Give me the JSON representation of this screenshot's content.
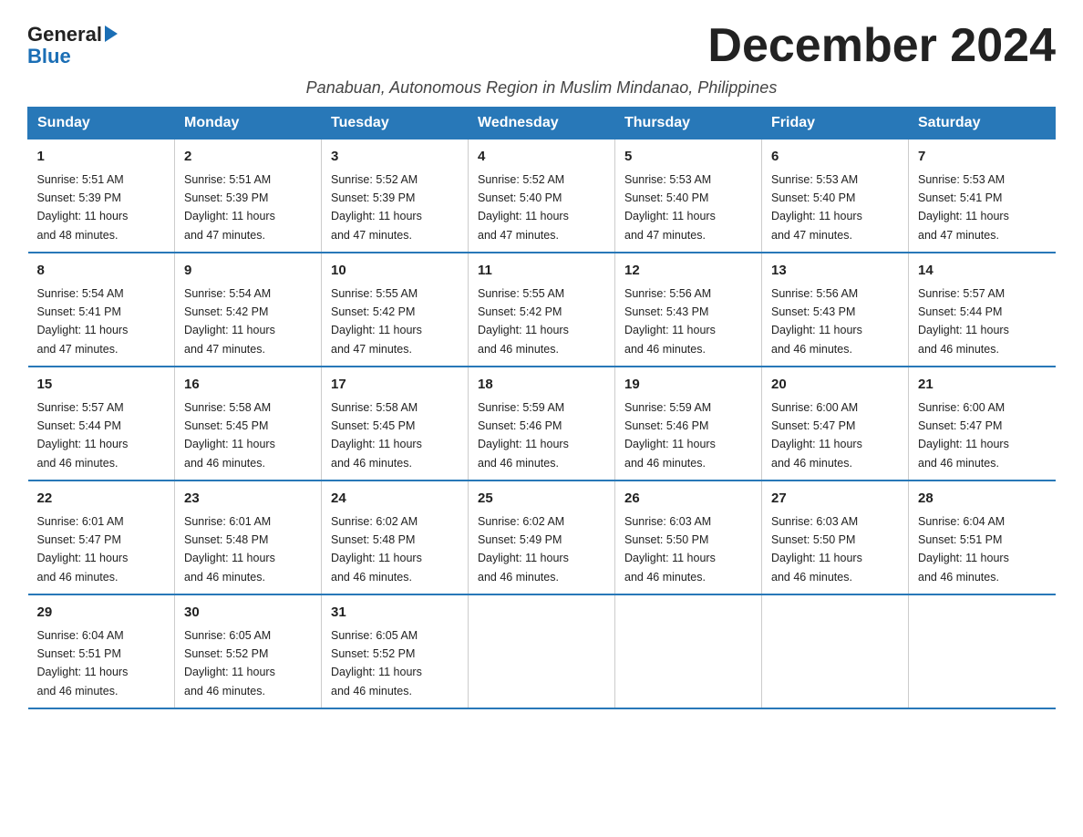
{
  "logo": {
    "text_general": "General",
    "text_blue": "Blue",
    "triangle": "▶"
  },
  "title": "December 2024",
  "subtitle": "Panabuan, Autonomous Region in Muslim Mindanao, Philippines",
  "weekdays": [
    "Sunday",
    "Monday",
    "Tuesday",
    "Wednesday",
    "Thursday",
    "Friday",
    "Saturday"
  ],
  "weeks": [
    [
      {
        "day": "1",
        "sunrise": "5:51 AM",
        "sunset": "5:39 PM",
        "daylight": "11 hours and 48 minutes."
      },
      {
        "day": "2",
        "sunrise": "5:51 AM",
        "sunset": "5:39 PM",
        "daylight": "11 hours and 47 minutes."
      },
      {
        "day": "3",
        "sunrise": "5:52 AM",
        "sunset": "5:39 PM",
        "daylight": "11 hours and 47 minutes."
      },
      {
        "day": "4",
        "sunrise": "5:52 AM",
        "sunset": "5:40 PM",
        "daylight": "11 hours and 47 minutes."
      },
      {
        "day": "5",
        "sunrise": "5:53 AM",
        "sunset": "5:40 PM",
        "daylight": "11 hours and 47 minutes."
      },
      {
        "day": "6",
        "sunrise": "5:53 AM",
        "sunset": "5:40 PM",
        "daylight": "11 hours and 47 minutes."
      },
      {
        "day": "7",
        "sunrise": "5:53 AM",
        "sunset": "5:41 PM",
        "daylight": "11 hours and 47 minutes."
      }
    ],
    [
      {
        "day": "8",
        "sunrise": "5:54 AM",
        "sunset": "5:41 PM",
        "daylight": "11 hours and 47 minutes."
      },
      {
        "day": "9",
        "sunrise": "5:54 AM",
        "sunset": "5:42 PM",
        "daylight": "11 hours and 47 minutes."
      },
      {
        "day": "10",
        "sunrise": "5:55 AM",
        "sunset": "5:42 PM",
        "daylight": "11 hours and 47 minutes."
      },
      {
        "day": "11",
        "sunrise": "5:55 AM",
        "sunset": "5:42 PM",
        "daylight": "11 hours and 46 minutes."
      },
      {
        "day": "12",
        "sunrise": "5:56 AM",
        "sunset": "5:43 PM",
        "daylight": "11 hours and 46 minutes."
      },
      {
        "day": "13",
        "sunrise": "5:56 AM",
        "sunset": "5:43 PM",
        "daylight": "11 hours and 46 minutes."
      },
      {
        "day": "14",
        "sunrise": "5:57 AM",
        "sunset": "5:44 PM",
        "daylight": "11 hours and 46 minutes."
      }
    ],
    [
      {
        "day": "15",
        "sunrise": "5:57 AM",
        "sunset": "5:44 PM",
        "daylight": "11 hours and 46 minutes."
      },
      {
        "day": "16",
        "sunrise": "5:58 AM",
        "sunset": "5:45 PM",
        "daylight": "11 hours and 46 minutes."
      },
      {
        "day": "17",
        "sunrise": "5:58 AM",
        "sunset": "5:45 PM",
        "daylight": "11 hours and 46 minutes."
      },
      {
        "day": "18",
        "sunrise": "5:59 AM",
        "sunset": "5:46 PM",
        "daylight": "11 hours and 46 minutes."
      },
      {
        "day": "19",
        "sunrise": "5:59 AM",
        "sunset": "5:46 PM",
        "daylight": "11 hours and 46 minutes."
      },
      {
        "day": "20",
        "sunrise": "6:00 AM",
        "sunset": "5:47 PM",
        "daylight": "11 hours and 46 minutes."
      },
      {
        "day": "21",
        "sunrise": "6:00 AM",
        "sunset": "5:47 PM",
        "daylight": "11 hours and 46 minutes."
      }
    ],
    [
      {
        "day": "22",
        "sunrise": "6:01 AM",
        "sunset": "5:47 PM",
        "daylight": "11 hours and 46 minutes."
      },
      {
        "day": "23",
        "sunrise": "6:01 AM",
        "sunset": "5:48 PM",
        "daylight": "11 hours and 46 minutes."
      },
      {
        "day": "24",
        "sunrise": "6:02 AM",
        "sunset": "5:48 PM",
        "daylight": "11 hours and 46 minutes."
      },
      {
        "day": "25",
        "sunrise": "6:02 AM",
        "sunset": "5:49 PM",
        "daylight": "11 hours and 46 minutes."
      },
      {
        "day": "26",
        "sunrise": "6:03 AM",
        "sunset": "5:50 PM",
        "daylight": "11 hours and 46 minutes."
      },
      {
        "day": "27",
        "sunrise": "6:03 AM",
        "sunset": "5:50 PM",
        "daylight": "11 hours and 46 minutes."
      },
      {
        "day": "28",
        "sunrise": "6:04 AM",
        "sunset": "5:51 PM",
        "daylight": "11 hours and 46 minutes."
      }
    ],
    [
      {
        "day": "29",
        "sunrise": "6:04 AM",
        "sunset": "5:51 PM",
        "daylight": "11 hours and 46 minutes."
      },
      {
        "day": "30",
        "sunrise": "6:05 AM",
        "sunset": "5:52 PM",
        "daylight": "11 hours and 46 minutes."
      },
      {
        "day": "31",
        "sunrise": "6:05 AM",
        "sunset": "5:52 PM",
        "daylight": "11 hours and 46 minutes."
      },
      null,
      null,
      null,
      null
    ]
  ],
  "labels": {
    "sunrise": "Sunrise:",
    "sunset": "Sunset:",
    "daylight": "Daylight:"
  }
}
